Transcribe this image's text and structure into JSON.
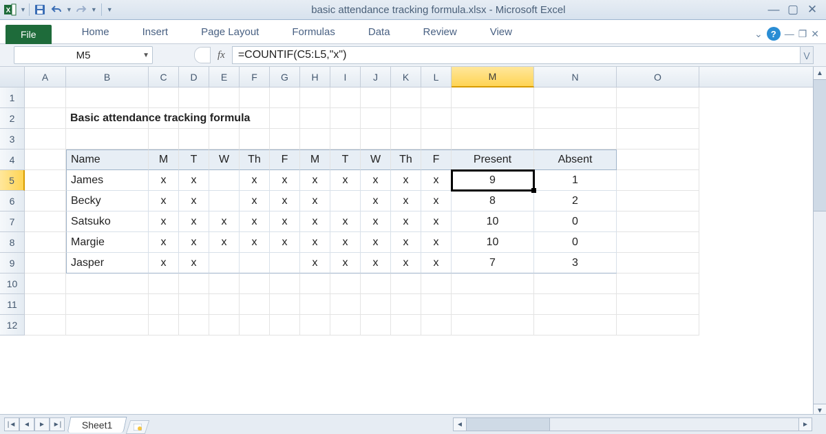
{
  "app": {
    "title": "basic attendance tracking formula.xlsx  -  Microsoft Excel"
  },
  "ribbon": {
    "file": "File",
    "tabs": [
      "Home",
      "Insert",
      "Page Layout",
      "Formulas",
      "Data",
      "Review",
      "View"
    ]
  },
  "fbar": {
    "name": "M5",
    "fx_label": "fx",
    "formula": "=COUNTIF(C5:L5,\"x\")"
  },
  "cols": [
    "A",
    "B",
    "C",
    "D",
    "E",
    "F",
    "G",
    "H",
    "I",
    "J",
    "K",
    "L",
    "M",
    "N",
    "O"
  ],
  "rows": [
    "1",
    "2",
    "3",
    "4",
    "5",
    "6",
    "7",
    "8",
    "9",
    "10",
    "11",
    "12"
  ],
  "selected": {
    "col": "M",
    "row": "5"
  },
  "sheet": {
    "title_cell": "Basic attendance tracking formula"
  },
  "table": {
    "headers": [
      "Name",
      "M",
      "T",
      "W",
      "Th",
      "F",
      "M",
      "T",
      "W",
      "Th",
      "F",
      "Present",
      "Absent"
    ],
    "rows": [
      {
        "name": "James",
        "att": [
          "x",
          "x",
          "",
          "x",
          "x",
          "x",
          "x",
          "x",
          "x",
          "x"
        ],
        "present": "9",
        "absent": "1"
      },
      {
        "name": "Becky",
        "att": [
          "x",
          "x",
          "",
          "x",
          "x",
          "x",
          "",
          "x",
          "x",
          "x"
        ],
        "present": "8",
        "absent": "2"
      },
      {
        "name": "Satsuko",
        "att": [
          "x",
          "x",
          "x",
          "x",
          "x",
          "x",
          "x",
          "x",
          "x",
          "x"
        ],
        "present": "10",
        "absent": "0"
      },
      {
        "name": "Margie",
        "att": [
          "x",
          "x",
          "x",
          "x",
          "x",
          "x",
          "x",
          "x",
          "x",
          "x"
        ],
        "present": "10",
        "absent": "0"
      },
      {
        "name": "Jasper",
        "att": [
          "x",
          "x",
          "",
          "",
          "",
          "x",
          "x",
          "x",
          "x",
          "x"
        ],
        "present": "7",
        "absent": "3"
      }
    ]
  },
  "sheetbar": {
    "active": "Sheet1"
  }
}
